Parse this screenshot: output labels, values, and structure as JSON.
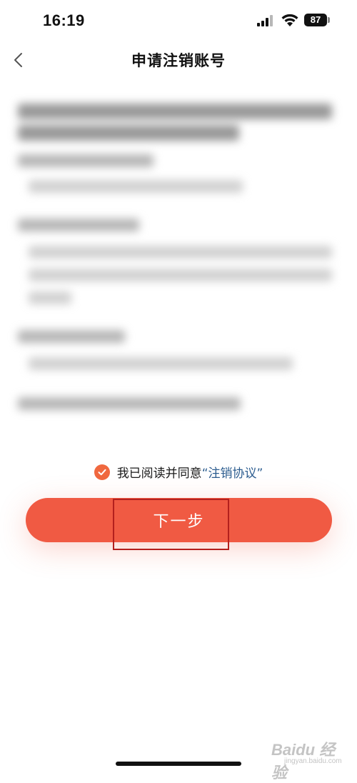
{
  "status_bar": {
    "time": "16:19",
    "battery": "87"
  },
  "nav": {
    "title": "申请注销账号",
    "back_icon": "chevron-left-icon"
  },
  "agreement": {
    "checked": true,
    "text": "我已阅读并同意",
    "link": "“注销协议”"
  },
  "next_button": {
    "label": "下一步"
  },
  "watermark": {
    "brand": "Baidu 经验",
    "url": "jingyan.baidu.com"
  },
  "colors": {
    "accent": "#f05a43",
    "check": "#f0683f",
    "link": "#2b5c8f",
    "highlight": "#b3201e"
  }
}
